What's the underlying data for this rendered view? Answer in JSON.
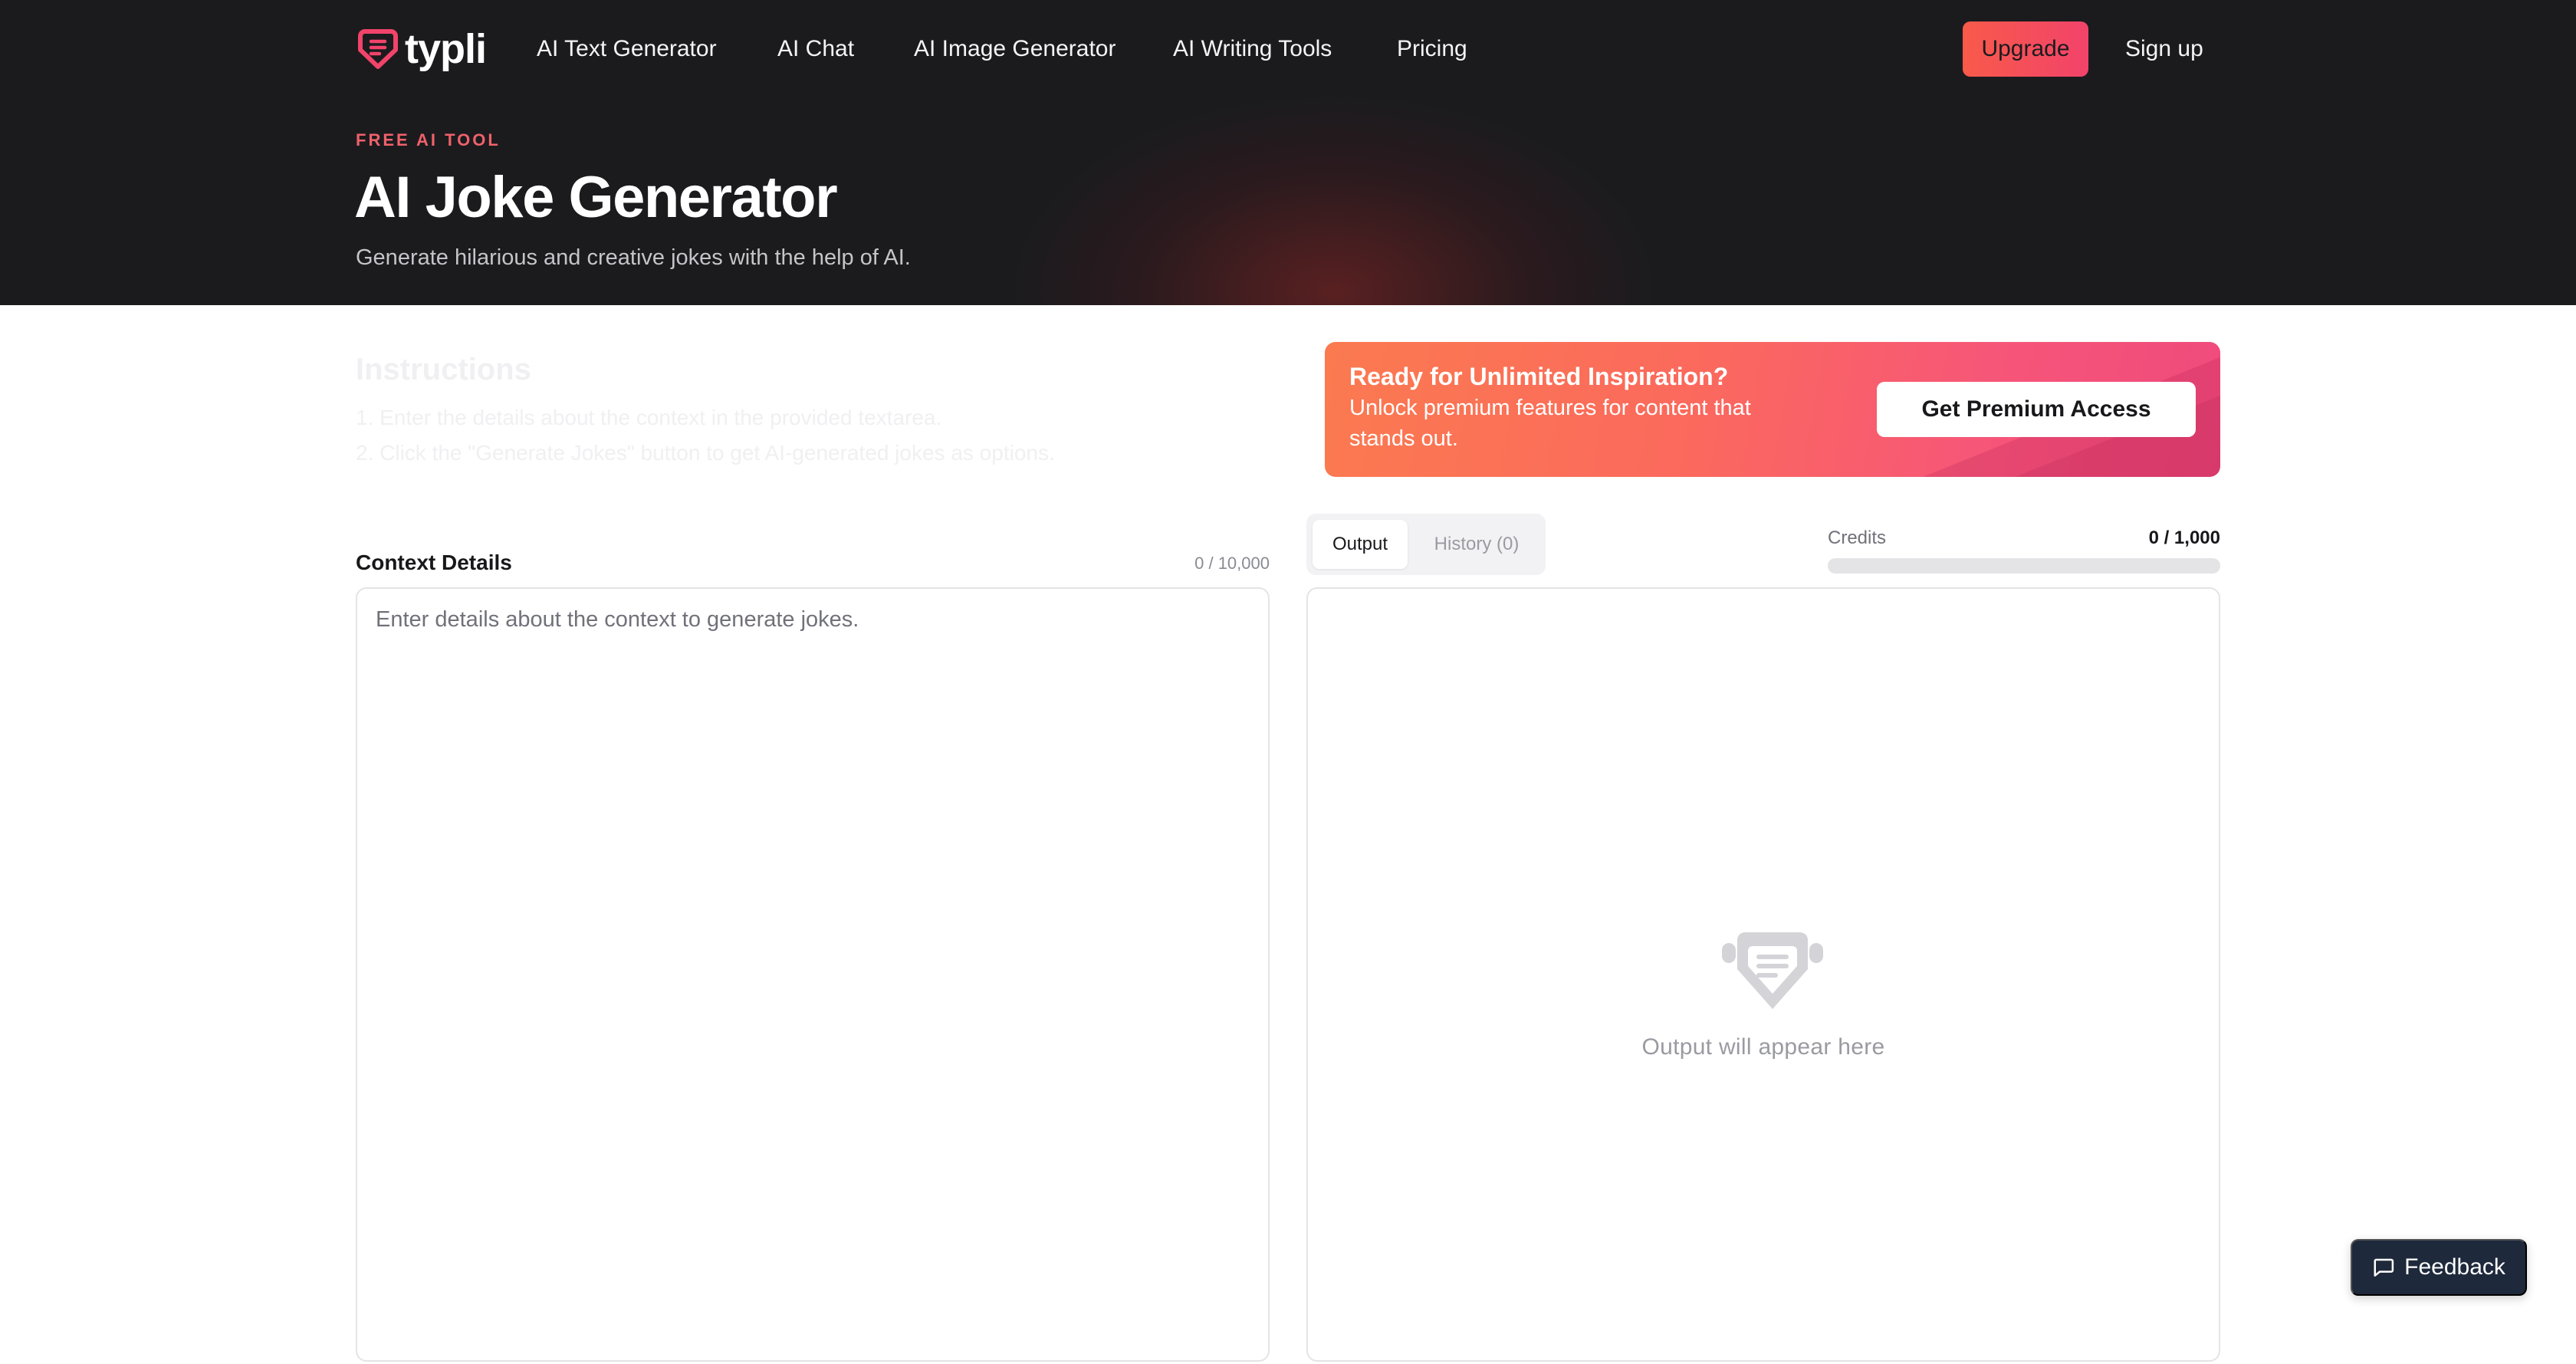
{
  "brand": {
    "name": "typli",
    "accent": "#f2436a"
  },
  "nav": {
    "links": [
      "AI Text Generator",
      "AI Chat",
      "AI Image Generator",
      "AI Writing Tools",
      "Pricing"
    ],
    "upgrade_label": "Upgrade",
    "signup_label": "Sign up"
  },
  "hero": {
    "eyebrow": "FREE AI TOOL",
    "title": "AI Joke Generator",
    "subtitle": "Generate hilarious and creative jokes with the help of AI."
  },
  "instructions": {
    "title": "Instructions",
    "steps": [
      "1. Enter the details about the context in the provided textarea.",
      "2. Click the \"Generate Jokes\" button to get AI-generated jokes as options."
    ]
  },
  "promo": {
    "title": "Ready for Unlimited Inspiration?",
    "text": "Unlock premium features for content that stands out.",
    "button_label": "Get Premium Access"
  },
  "input": {
    "label": "Context Details",
    "char_count": "0 / 10,000",
    "placeholder": "Enter details about the context to generate jokes.",
    "value": ""
  },
  "output": {
    "tabs": {
      "output": "Output",
      "history": "History (0)"
    },
    "active_tab": "Output",
    "credits_label": "Credits",
    "credits_value": "0 / 1,000",
    "credits_used_fraction": 0,
    "placeholder": "Output will appear here"
  },
  "feedback": {
    "label": "Feedback"
  },
  "icons": [
    "typli-logo-icon",
    "output-placeholder-icon",
    "chat-bubble-icon"
  ]
}
